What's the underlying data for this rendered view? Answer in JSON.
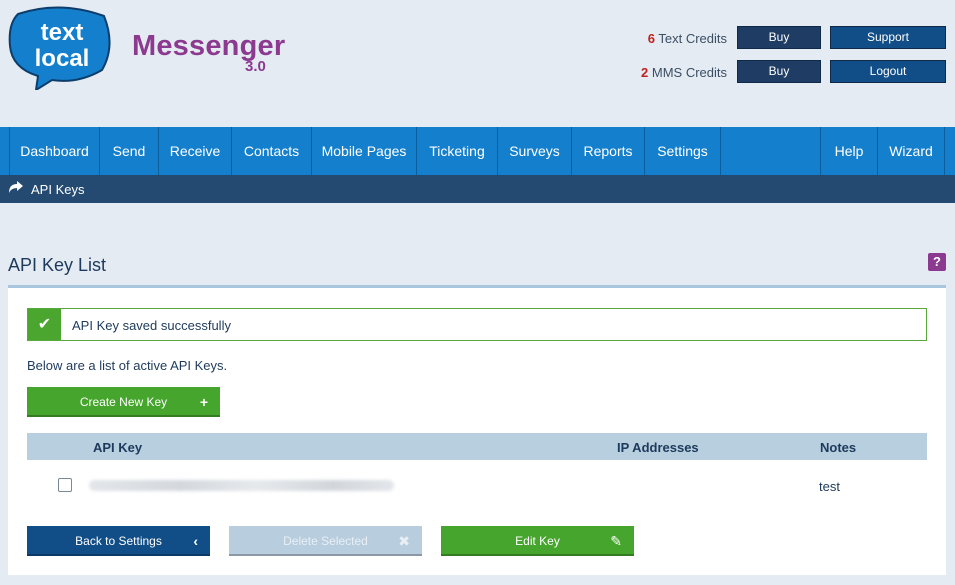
{
  "brand": {
    "logo_line1": "text",
    "logo_line2": "local",
    "product": "Messenger",
    "version": "3.0"
  },
  "credits": {
    "text": {
      "count": "6",
      "label": "Text Credits"
    },
    "mms": {
      "count": "2",
      "label": "MMS Credits"
    }
  },
  "header_buttons": {
    "buy_text": "Buy",
    "buy_mms": "Buy",
    "support": "Support",
    "logout": "Logout"
  },
  "nav": {
    "items": [
      "Dashboard",
      "Send",
      "Receive",
      "Contacts",
      "Mobile Pages",
      "Ticketing",
      "Surveys",
      "Reports",
      "Settings"
    ],
    "right_items": [
      "Help",
      "Wizard"
    ]
  },
  "breadcrumb": {
    "label": "API Keys"
  },
  "page": {
    "title": "API Key List",
    "help": "?"
  },
  "alert": {
    "message": "API Key saved successfully"
  },
  "intro": "Below are a list of active API Keys.",
  "buttons": {
    "create": "Create New Key",
    "back": "Back to Settings",
    "delete": "Delete Selected",
    "edit": "Edit Key"
  },
  "table": {
    "headers": {
      "key": "API Key",
      "ip": "IP Addresses",
      "notes": "Notes"
    },
    "rows": [
      {
        "key": "",
        "ip": "",
        "notes": "test"
      }
    ]
  },
  "colors": {
    "nav": "#1480cd",
    "breadcrumb": "#244a72",
    "brand": "#8b3a8f",
    "success": "#46a52c",
    "primary": "#114d87"
  }
}
